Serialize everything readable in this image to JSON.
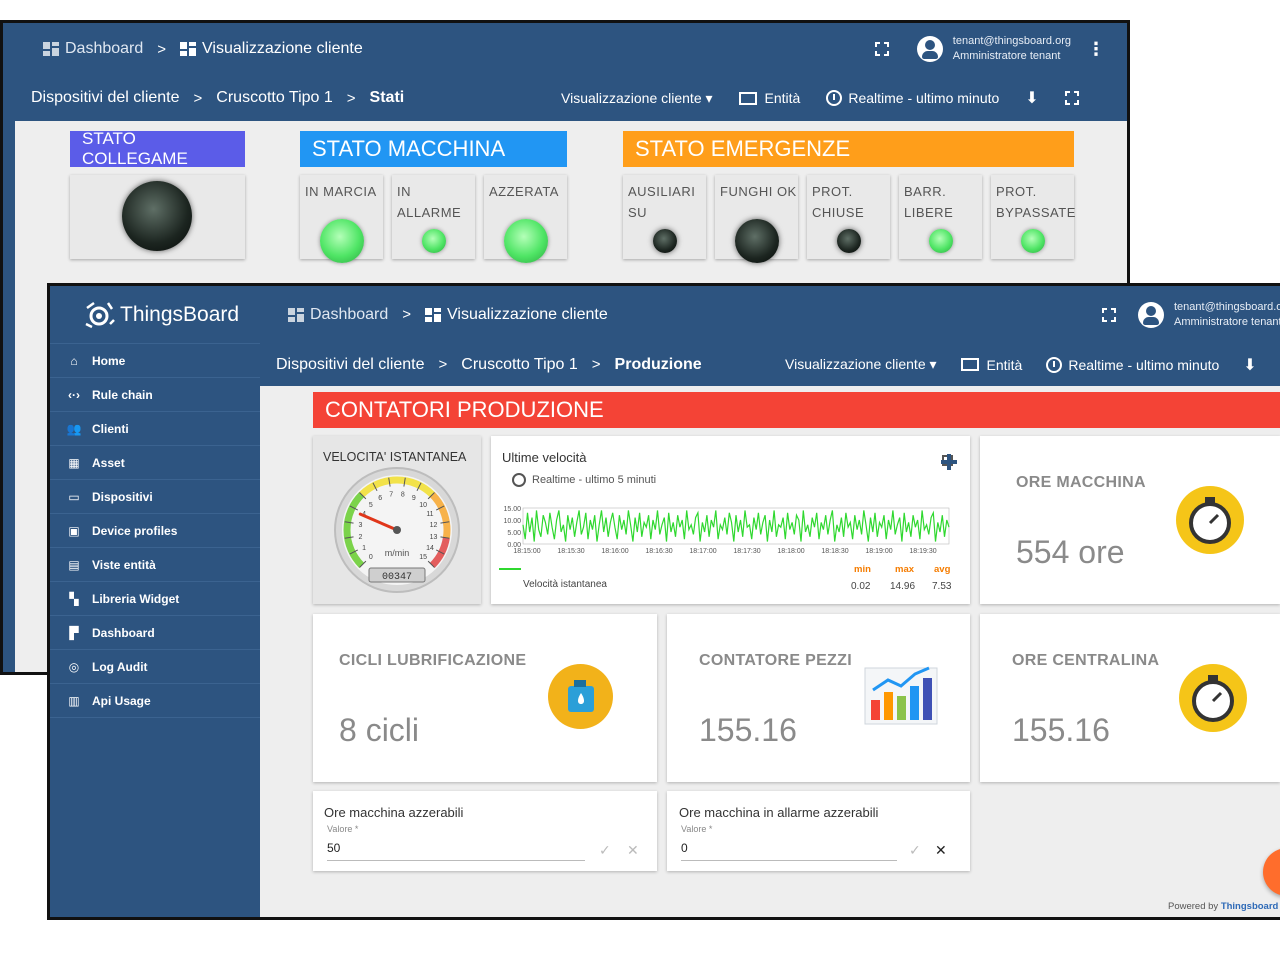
{
  "back_window": {
    "breadcrumb": {
      "dashboard": "Dashboard",
      "separator": ">",
      "current": "Visualizzazione cliente"
    },
    "user": {
      "email": "tenant@thingsboard.org",
      "role": "Amministratore tenant"
    },
    "subbar": {
      "crumb1": "Dispositivi del cliente",
      "crumb2": "Cruscotto Tipo 1",
      "crumb3": "Stati",
      "view_select": "Visualizzazione cliente ▾",
      "entities": "Entità",
      "timewindow": "Realtime - ultimo minuto"
    },
    "sections": {
      "collegame": {
        "title": "STATO COLLEGAME",
        "color": "#5b5ce8"
      },
      "macchina": {
        "title": "STATO MACCHINA",
        "color": "#2196f3",
        "leds": [
          {
            "label": "IN MARCIA",
            "state": "on"
          },
          {
            "label": "IN ALLARME",
            "state": "on"
          },
          {
            "label": "AZZERATA",
            "state": "on"
          }
        ]
      },
      "emergenze": {
        "title": "STATO EMERGENZE",
        "color": "#ff9e1a",
        "leds": [
          {
            "label": "AUSILIARI SU",
            "state": "off"
          },
          {
            "label": "FUNGHI OK",
            "state": "off"
          },
          {
            "label": "PROT. CHIUSE",
            "state": "off"
          },
          {
            "label": "BARR. LIBERE",
            "state": "on"
          },
          {
            "label": "PROT. BYPASSATE",
            "state": "on"
          }
        ]
      }
    }
  },
  "front_window": {
    "brand": "ThingsBoard",
    "breadcrumb": {
      "dashboard": "Dashboard",
      "separator": ">",
      "current": "Visualizzazione cliente"
    },
    "user": {
      "email": "tenant@thingsboard.org",
      "role": "Amministratore tenant"
    },
    "subbar": {
      "crumb1": "Dispositivi del cliente",
      "crumb2": "Cruscotto Tipo 1",
      "crumb3": "Produzione",
      "view_select": "Visualizzazione cliente ▾",
      "entities": "Entità",
      "timewindow": "Realtime - ultimo minuto"
    },
    "sidebar": [
      {
        "label": "Home",
        "icon": "home-icon"
      },
      {
        "label": "Rule chain",
        "icon": "code-arrows-icon"
      },
      {
        "label": "Clienti",
        "icon": "people-icon"
      },
      {
        "label": "Asset",
        "icon": "asset-icon"
      },
      {
        "label": "Dispositivi",
        "icon": "devices-icon"
      },
      {
        "label": "Device profiles",
        "icon": "device-profile-icon"
      },
      {
        "label": "Viste entità",
        "icon": "entity-view-icon"
      },
      {
        "label": "Libreria Widget",
        "icon": "widget-library-icon"
      },
      {
        "label": "Dashboard",
        "icon": "dashboard-icon"
      },
      {
        "label": "Log Audit",
        "icon": "audit-log-icon"
      },
      {
        "label": "Api Usage",
        "icon": "api-usage-icon"
      }
    ],
    "section_title": "CONTATORI PRODUZIONE",
    "section_color": "#f44336",
    "gauge": {
      "title": "VELOCITA' ISTANTANEA",
      "unit": "m/min",
      "odometer": "00347",
      "ticks": [
        "0",
        "1",
        "2",
        "3",
        "4",
        "5",
        "6",
        "7",
        "8",
        "9",
        "10",
        "11",
        "12",
        "13",
        "14",
        "15"
      ],
      "value": 3.8
    },
    "speed_chart": {
      "title": "Ultime velocità",
      "subtitle": "Realtime - ultimo 5 minuti",
      "legend": "Velocità istantanea",
      "min_label": "min",
      "max_label": "max",
      "avg_label": "avg",
      "min": "0.02",
      "max": "14.96",
      "avg": "7.53"
    },
    "chart_data": {
      "type": "line",
      "title": "Ultime velocità",
      "y_ticks": [
        "15.00",
        "10.00",
        "5.00",
        "0.00"
      ],
      "ylim": [
        0,
        15
      ],
      "x_ticks": [
        "18:15:00",
        "18:15:30",
        "18:16:00",
        "18:16:30",
        "18:17:00",
        "18:17:30",
        "18:18:00",
        "18:18:30",
        "18:19:00",
        "18:19:30"
      ],
      "series": [
        {
          "name": "Velocità istantanea",
          "color": "#2fd82f",
          "values": [
            8,
            2,
            13,
            5,
            11,
            1,
            14,
            6,
            3,
            12,
            9,
            4,
            13,
            7,
            2,
            10,
            14,
            5,
            8,
            1,
            12,
            6,
            11,
            3,
            9,
            14,
            4,
            7,
            13,
            2,
            10,
            6,
            12,
            1,
            8,
            14,
            5,
            11,
            3,
            9,
            13,
            7,
            2,
            12,
            6,
            10,
            4,
            14,
            8,
            1,
            11,
            5,
            13,
            3,
            9,
            7,
            12,
            2,
            10,
            6,
            14,
            4,
            8,
            11,
            1,
            13,
            5,
            9,
            3,
            12,
            7,
            10,
            2,
            14,
            6,
            8,
            4,
            11,
            13,
            1,
            9,
            5,
            12,
            3,
            10,
            7,
            14,
            2,
            8,
            6,
            11,
            4,
            13,
            9,
            1,
            12,
            5,
            10,
            3,
            14,
            7,
            8,
            2,
            11,
            6,
            13,
            4,
            9,
            12,
            1,
            10,
            5,
            14,
            3,
            8,
            7,
            11,
            2,
            13,
            6,
            9,
            4,
            12,
            10,
            1,
            14,
            5,
            8,
            3,
            11,
            7,
            13,
            2,
            9,
            6,
            12,
            4,
            10,
            14,
            1,
            8,
            5,
            11,
            3,
            13,
            7,
            9,
            2,
            12,
            6,
            10,
            4,
            14,
            8,
            1,
            11,
            5,
            13,
            3,
            9,
            7,
            12,
            2,
            10,
            6,
            14,
            4,
            8,
            11,
            1,
            13,
            5,
            9,
            3,
            12,
            7,
            10,
            2,
            14,
            6,
            8,
            4,
            11,
            13,
            1,
            9,
            5,
            12,
            3,
            10,
            7
          ]
        }
      ]
    },
    "ore_macchina": {
      "title": "ORE MACCHINA",
      "value": "554 ore"
    },
    "cicli": {
      "title": "CICLI LUBRIFICAZIONE",
      "value": "8 cicli"
    },
    "contatore": {
      "title": "CONTATORE PEZZI",
      "value": "155.16"
    },
    "ore_centralina": {
      "title": "ORE CENTRALINA",
      "value": "155.16"
    },
    "reset1": {
      "title": "Ore macchina azzerabili",
      "field_label": "Valore *",
      "value": "50"
    },
    "reset2": {
      "title": "Ore macchina in allarme azzerabili",
      "field_label": "Valore *",
      "value": "0"
    },
    "footer": {
      "powered": "Powered by",
      "brand": "Thingsboard"
    }
  }
}
